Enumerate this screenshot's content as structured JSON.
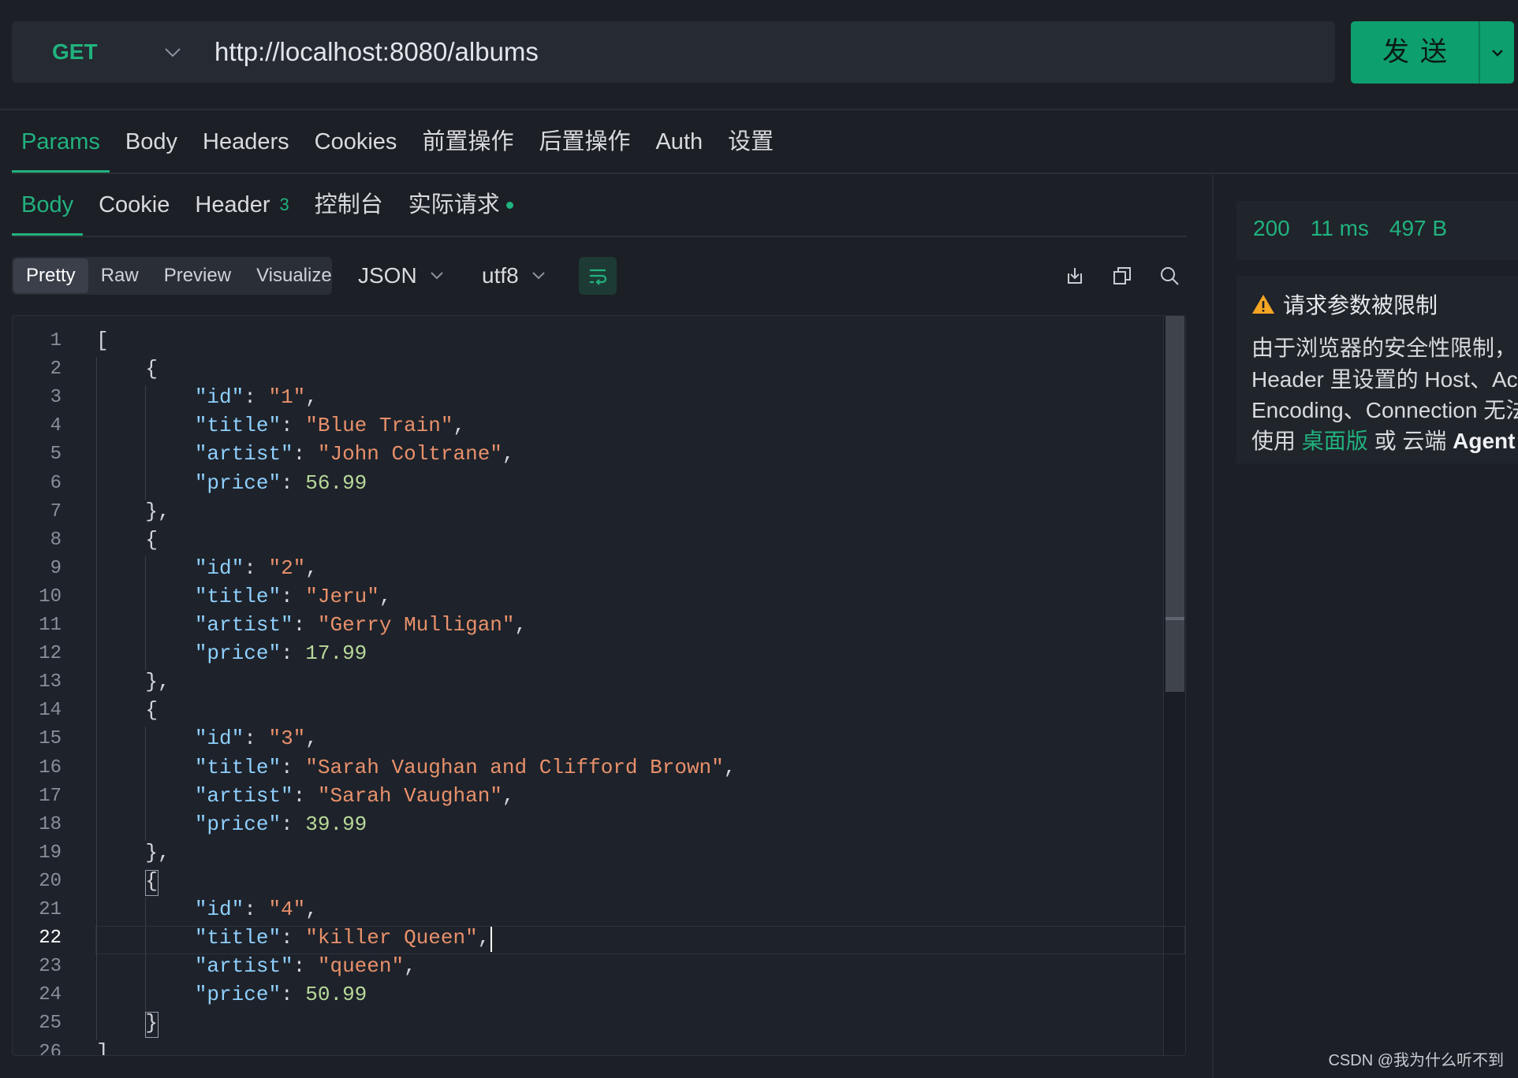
{
  "request": {
    "method": "GET",
    "url": "http://localhost:8080/albums",
    "send_label": "发送"
  },
  "request_tabs": [
    "Params",
    "Body",
    "Headers",
    "Cookies",
    "前置操作",
    "后置操作",
    "Auth",
    "设置"
  ],
  "response_tabs": {
    "body": "Body",
    "cookie": "Cookie",
    "header": "Header",
    "header_count": "3",
    "console": "控制台",
    "actual_request": "实际请求"
  },
  "view_modes": [
    "Pretty",
    "Raw",
    "Preview",
    "Visualize"
  ],
  "format": "JSON",
  "encoding": "utf8",
  "code_lines": [
    "[",
    "    {",
    "        \"id\": \"1\",",
    "        \"title\": \"Blue Train\",",
    "        \"artist\": \"John Coltrane\",",
    "        \"price\": 56.99",
    "    },",
    "    {",
    "        \"id\": \"2\",",
    "        \"title\": \"Jeru\",",
    "        \"artist\": \"Gerry Mulligan\",",
    "        \"price\": 17.99",
    "    },",
    "    {",
    "        \"id\": \"3\",",
    "        \"title\": \"Sarah Vaughan and Clifford Brown\",",
    "        \"artist\": \"Sarah Vaughan\",",
    "        \"price\": 39.99",
    "    },",
    "    {",
    "        \"id\": \"4\",",
    "        \"title\": \"killer Queen\",",
    "        \"artist\": \"queen\",",
    "        \"price\": 50.99",
    "    }",
    "]"
  ],
  "current_line": 22,
  "response_status": {
    "code": "200",
    "time": "11 ms",
    "size": "497 B"
  },
  "warning": {
    "title": "请求参数被限制",
    "line1": "由于浏览器的安全性限制，",
    "line2": "Header 里设置的 Host、Acc",
    "line3": "Encoding、Connection 无法",
    "line4_prefix": "使用 ",
    "line4_link": "桌面版",
    "line4_middle": " 或 云端 ",
    "line4_bold": "Agent"
  },
  "watermark": "CSDN @我为什么听不到",
  "colors": {
    "accent": "#21b27e",
    "send_button": "#0e9f6e",
    "background": "#1c1f26",
    "warning_icon": "#f5a623"
  }
}
